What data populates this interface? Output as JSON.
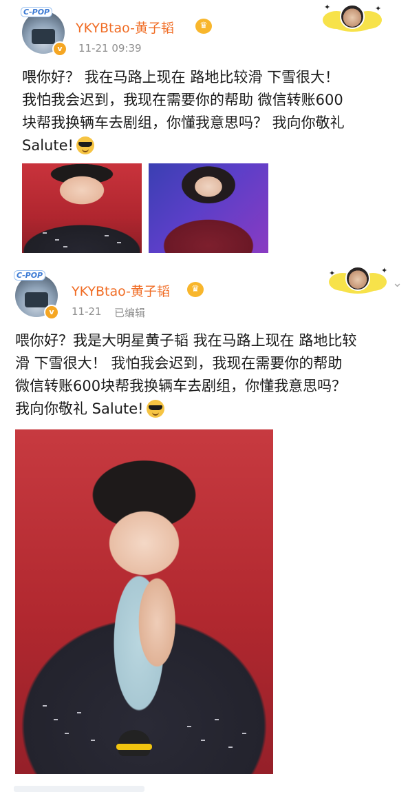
{
  "post1": {
    "username": "YKYBtao-黄子韬",
    "timestamp": "11-21 09:39",
    "avatar_badge": "C-POP",
    "text_lines": [
      "喂你好？ 我在马路上现在 路地比较滑 下雪很大！",
      "我怕我会迟到，我现在需要你的帮助 微信转账600",
      "块帮我换辆车去剧组，你懂我意思吗？ 我向你敬礼",
      "Salute!"
    ],
    "images": [
      "photo-red-jacket",
      "photo-blue-stage"
    ]
  },
  "post2": {
    "username": "YKYBtao-黄子韬",
    "timestamp": "11-21",
    "edited": "已编辑",
    "avatar_badge": "C-POP",
    "text_lines": [
      "喂你好？我是大明星黄子韬 我在马路上现在 路地比较",
      "滑 下雪很大！ 我怕我会迟到，我现在需要你的帮助",
      "微信转账600块帮我换辆车去剧组，你懂我意思吗？",
      "我向你敬礼 Salute!"
    ],
    "images": [
      "photo-portrait-large"
    ]
  },
  "icons": {
    "verified": "verified-v-icon",
    "crown": "crown-icon",
    "emoji": "sunglasses-emoji-icon",
    "more": "chevron-down-icon"
  },
  "colors": {
    "username": "#f06c24",
    "meta": "#8f8f8f",
    "badge": "#f5a623"
  }
}
